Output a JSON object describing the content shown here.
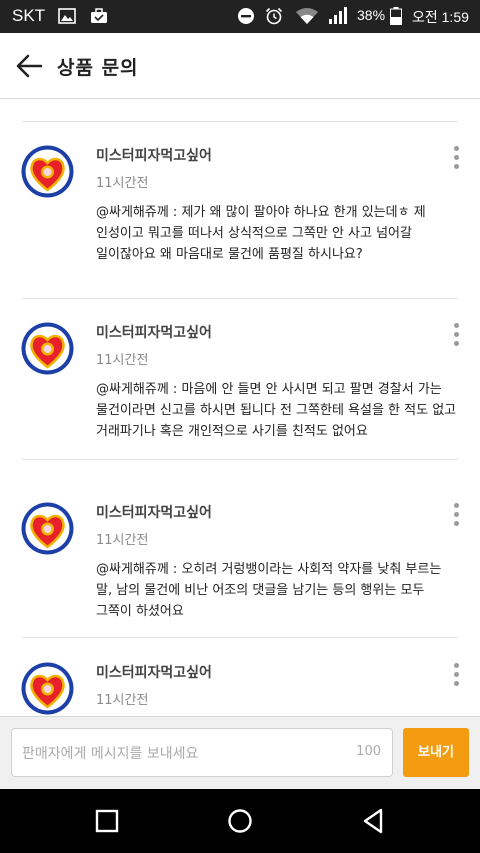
{
  "status_bar": {
    "carrier": "SKT",
    "battery": "38%",
    "time": "오전 1:59",
    "icons": [
      "image-icon",
      "briefcase-icon",
      "dnd-icon",
      "alarm-icon",
      "wifi-icon",
      "signal-icon",
      "battery-icon"
    ]
  },
  "header": {
    "back_icon": "arrow-left-icon",
    "title": "상품 문의"
  },
  "comments": [
    {
      "nickname": "미스터피자먹고싶어",
      "time": "11시간전",
      "text": "@싸게해쥬께 : 제가 왜 많이 팔아야 하나요 한개 있는데ㅎ 제 인성이고 뭐고를 떠나서 상식적으로 그쪽만 안 사고 넘어갈 일이잖아요 왜 마음대로 물건에 품평질 하시나요?"
    },
    {
      "nickname": "미스터피자먹고싶어",
      "time": "11시간전",
      "text": "@싸게해쥬께 : 마음에 안 들면 안 사시면 되고 팔면 경찰서 가는 물건이라면 신고를 하시면 됩니다 전 그쪽한테 욕설을 한 적도 없고 거래파기나 혹은 개인적으로 사기를 친적도 없어요"
    },
    {
      "nickname": "미스터피자먹고싶어",
      "time": "11시간전",
      "text": "@싸게해쥬께 : 오히려 거렁뱅이라는 사회적 약자를 낮춰 부르는 말, 남의 물건에 비난 어조의 댓글을 남기는 등의 행위는 모두 그쪽이 하셨어요"
    },
    {
      "nickname": "미스터피자먹고싶어",
      "time": "11시간전",
      "text": ""
    }
  ],
  "input_bar": {
    "placeholder": "판매자에게 메시지를 보내세요",
    "char_limit": "100",
    "send_label": "보내기"
  },
  "nav_bar": {
    "buttons": [
      "recent-apps-icon",
      "home-icon",
      "back-icon"
    ]
  },
  "colors": {
    "accent": "#f39c12",
    "status_bar_bg": "#222222",
    "nav_bar_bg": "#000000"
  }
}
